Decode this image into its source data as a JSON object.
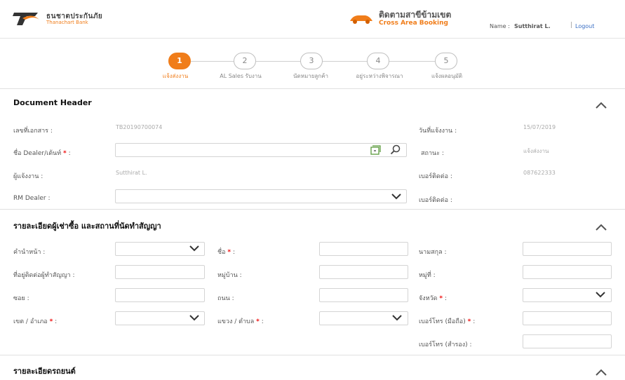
{
  "header": {
    "brand_name": "ธนชาตประกันภัย",
    "brand_sub": "Thanachart Bank",
    "center_title": "ติดตามสาขีข้ามเขต",
    "center_sub": "Cross Area Booking",
    "user_label": "Name :",
    "user_name": "Sutthirat L.",
    "separator": "|",
    "logout_label": "Logout"
  },
  "steps": [
    {
      "number": "1",
      "label": "แจ้งส่งงาน",
      "active": true
    },
    {
      "number": "2",
      "label": "AL Sales รับงาน",
      "active": false
    },
    {
      "number": "3",
      "label": "นัดหมายลูกค้า",
      "active": false
    },
    {
      "number": "4",
      "label": "อยู่ระหว่างพิจารณา",
      "active": false
    },
    {
      "number": "5",
      "label": "แจ้งผลอนุมัติ",
      "active": false
    }
  ],
  "document_header": {
    "title": "Document Header",
    "doc_no_label": "เลขที่เอกสาร :",
    "doc_no_value": "TB20190700074",
    "date_label": "วันที่แจ้งงาน :",
    "date_value": "15/07/2019",
    "dealer_label": "ชื่อ Dealer/เต้นท์",
    "dealer_value": "",
    "status_label": "สถานะ :",
    "status_value": "แจ้งส่งงาน",
    "reporter_label": "ผู้แจ้งงาน :",
    "reporter_value": "Sutthirat L.",
    "contact_label": "เบอร์ติดต่อ :",
    "contact_value": "087622333",
    "rm_label": "RM Dealer :",
    "rm_value": "",
    "contact2_label": "เบอร์ติดต่อ :"
  },
  "lessee_section": {
    "title": "รายละเอียดผู้เช่าซื้อ และสถานที่นัดทำสัญญา",
    "prefix_label": "คำนำหน้า :",
    "name_label": "ชื่อ",
    "surname_label": "นามสกุล :",
    "address_label": "ที่อยู่ติดต่อผู้ทำสัญญา :",
    "village_label": "หมู่บ้าน :",
    "moo_label": "หมู่ที่ :",
    "soi_label": "ซอย :",
    "road_label": "ถนน :",
    "province_label": "จังหวัด",
    "district_label": "เขต / อำเภอ",
    "subdistrict_label": "แขวง / ตำบล",
    "mobile_label": "เบอร์โทร (มือถือ)",
    "backup_phone_label": "เบอร์โทร (สำรอง) :",
    "colon": ":"
  },
  "car_section": {
    "title": "รายละเอียดรถยนต์"
  },
  "colors": {
    "accent": "#f07d1a",
    "required": "#e11111",
    "link": "#3a6fc4"
  }
}
